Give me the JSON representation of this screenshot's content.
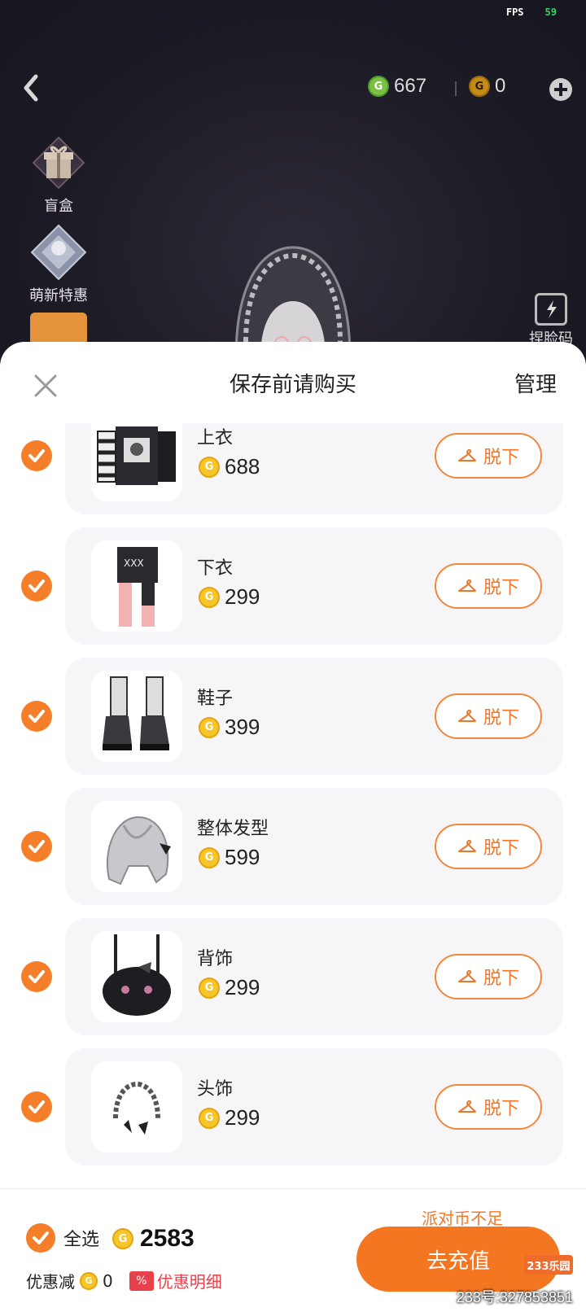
{
  "status": {
    "fps_label": "FPS",
    "fps_value": "59"
  },
  "topbar": {
    "green_currency": "667",
    "gold_currency": "0",
    "green_coin_icon": "g-coin-icon",
    "gold_coin_icon": "g-coin-icon"
  },
  "side": {
    "blind_box": "盲盒",
    "newbie_deal": "萌新特惠",
    "face_code": "捏脸码"
  },
  "sheet": {
    "title": "保存前请购买",
    "manage": "管理"
  },
  "items": [
    {
      "name": "上衣",
      "price": "688",
      "action": "脱下"
    },
    {
      "name": "下衣",
      "price": "299",
      "action": "脱下"
    },
    {
      "name": "鞋子",
      "price": "399",
      "action": "脱下"
    },
    {
      "name": "整体发型",
      "price": "599",
      "action": "脱下"
    },
    {
      "name": "背饰",
      "price": "299",
      "action": "脱下"
    },
    {
      "name": "头饰",
      "price": "299",
      "action": "脱下"
    }
  ],
  "footer": {
    "insufficient": "派对币不足",
    "select_all": "全选",
    "total": "2583",
    "discount_label": "优惠减",
    "discount_value": "0",
    "detail_pct": "%",
    "detail_label": "优惠明细",
    "recharge": "去充值"
  },
  "watermark": {
    "logo": "233乐园",
    "text": "233号:327853851"
  },
  "colors": {
    "accent": "#f57620",
    "check": "#f57e2b",
    "coin": "#f6c629"
  }
}
